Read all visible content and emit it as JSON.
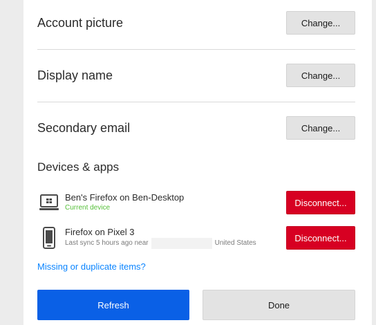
{
  "account": {
    "picture": {
      "label": "Account picture",
      "button": "Change..."
    },
    "display_name": {
      "label": "Display name",
      "button": "Change..."
    },
    "secondary_email": {
      "label": "Secondary email",
      "button": "Change..."
    }
  },
  "devices": {
    "title": "Devices & apps",
    "items": [
      {
        "name": "Ben's Firefox on Ben-Desktop",
        "status": "Current device",
        "icon": "desktop-icon",
        "button": "Disconnect..."
      },
      {
        "name": "Firefox on Pixel 3",
        "status_prefix": "Last sync 5 hours ago near",
        "location": "United States",
        "icon": "phone-icon",
        "button": "Disconnect..."
      }
    ]
  },
  "link": {
    "missing_items": "Missing or duplicate items?"
  },
  "footer": {
    "refresh": "Refresh",
    "done": "Done"
  },
  "colors": {
    "primary": "#0a60e6",
    "danger": "#d70022",
    "link": "#0a84ff",
    "current": "#57c03b"
  }
}
